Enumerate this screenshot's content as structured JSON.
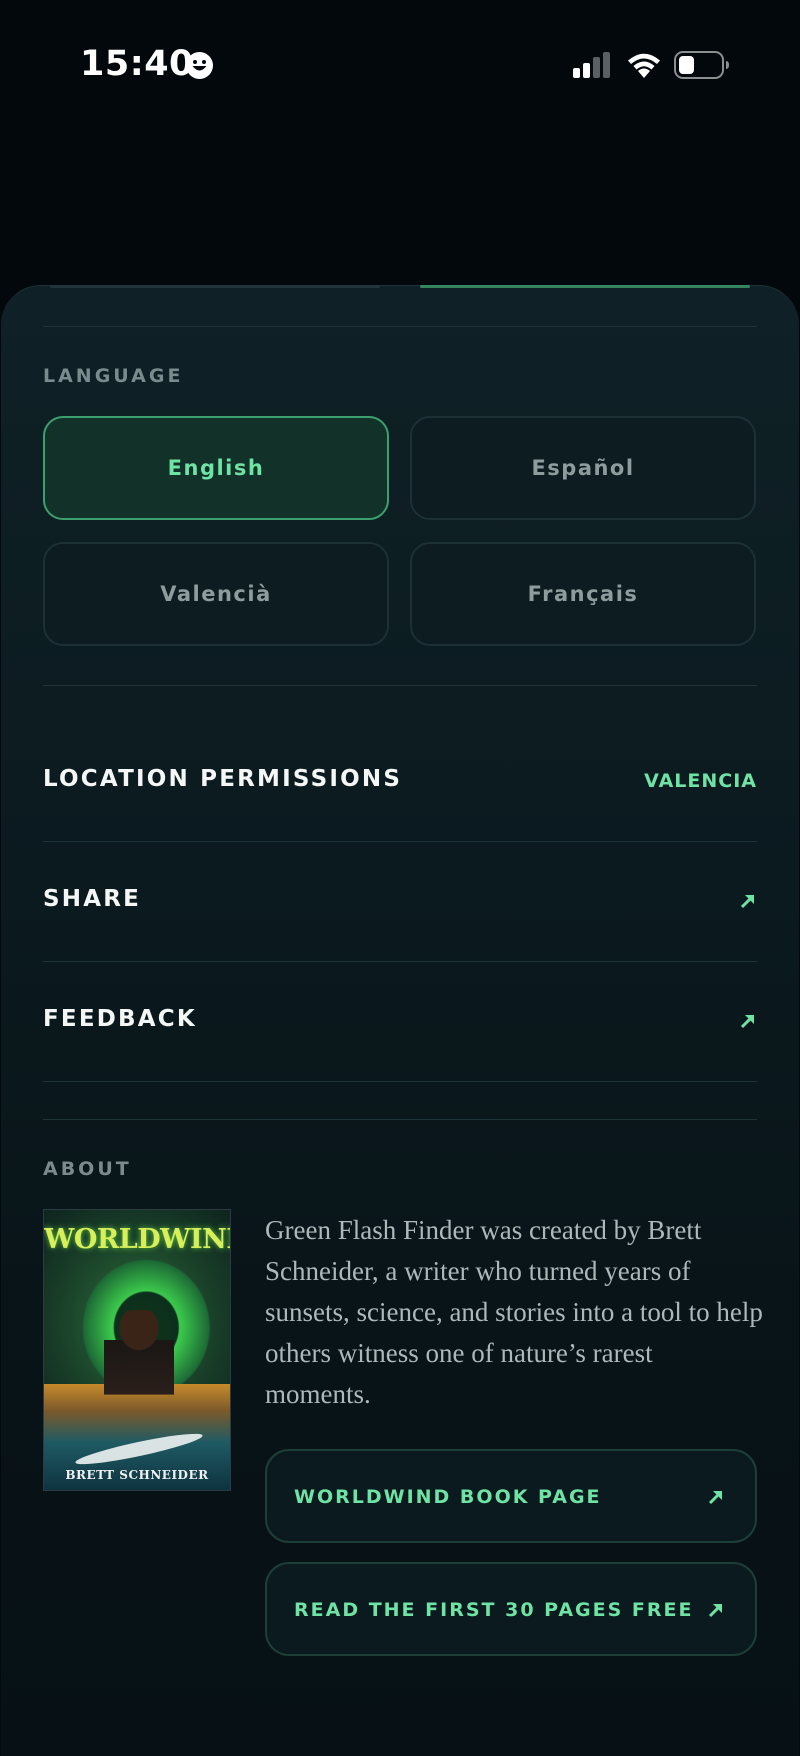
{
  "status_bar": {
    "time": "15:40"
  },
  "language": {
    "label": "LANGUAGE",
    "options": [
      "English",
      "Español",
      "Valencià",
      "Français"
    ],
    "selected": "English"
  },
  "location": {
    "title": "LOCATION PERMISSIONS",
    "value": "VALENCIA"
  },
  "share": {
    "title": "SHARE"
  },
  "feedback": {
    "title": "FEEDBACK"
  },
  "about": {
    "label": "ABOUT",
    "cover_title": "WORLDWIND",
    "cover_author": "BRETT SCHNEIDER",
    "description": "Green Flash Finder was created by Brett Schneider, a writer who turned years of sunsets, science, and stories into a tool to help others witness one of nature’s rarest moments.",
    "links": [
      {
        "label": "WORLDWIND BOOK PAGE"
      },
      {
        "label": "READ THE FIRST 30 PAGES FREE"
      }
    ]
  },
  "colors": {
    "accent": "#6ee3a4",
    "background": "#03080c",
    "sheet": "#0b1a1f"
  }
}
